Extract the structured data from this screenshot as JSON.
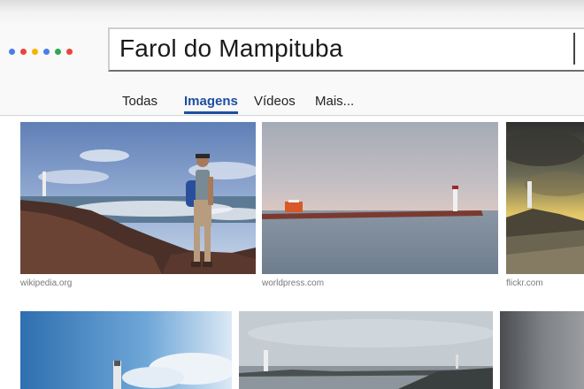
{
  "search": {
    "query": "Farol do Mampituba"
  },
  "dots": [
    "#4a7de8",
    "#e8453c",
    "#f5b400",
    "#4a7de8",
    "#2fa84f",
    "#e8453c"
  ],
  "tabs": [
    {
      "label": "Todas",
      "active": false
    },
    {
      "label": "Imagens",
      "active": true
    },
    {
      "label": "Vídeos",
      "active": false
    },
    {
      "label": "Mais...",
      "active": false
    }
  ],
  "results": [
    {
      "source": "wikipedia.org",
      "subject": "hiker-on-rocks-by-lighthouse"
    },
    {
      "source": "worldpress.com",
      "subject": "pier-with-lighthouse-at-dusk"
    },
    {
      "source": "flickr.com",
      "subject": "lighthouse-at-sunset"
    },
    {
      "source": "",
      "subject": "lighthouse-blue-sky"
    },
    {
      "source": "",
      "subject": "jetty-with-lighthouse"
    },
    {
      "source": "",
      "subject": "grey-sky"
    }
  ],
  "colors": {
    "accent": "#1c4fa0"
  }
}
